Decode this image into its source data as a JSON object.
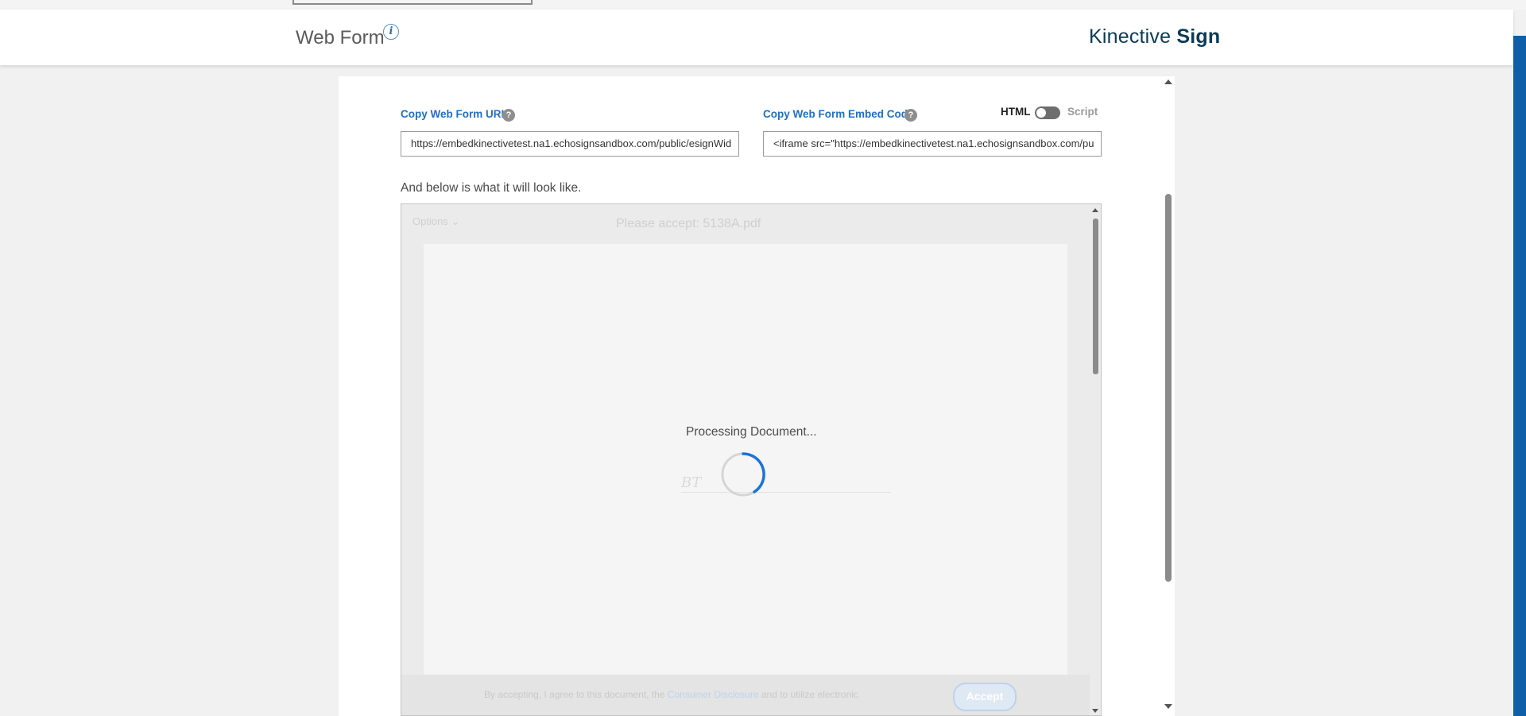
{
  "header": {
    "page_title": "Web Form",
    "info_icon": "i",
    "brand_light": "Kinective",
    "brand_bold": "Sign"
  },
  "form": {
    "url_label": "Copy Web Form URL",
    "url_value": "https://embedkinectivetest.na1.echosignsandbox.com/public/esignWid",
    "embed_label": "Copy Web Form Embed Code",
    "embed_value": "<iframe src=\"https://embedkinectivetest.na1.echosignsandbox.com/pu",
    "help_glyph": "?",
    "toggle_left": "HTML",
    "toggle_right": "Script",
    "toggle_state": "HTML"
  },
  "preview": {
    "caption": "And below is what it will look like.",
    "options_label": "Options ⌄",
    "doc_title": "Please accept: 5138A.pdf",
    "processing_text": "Processing Document...",
    "signature_mark": "BT",
    "footer_text_before": "By accepting, I agree to this document, the ",
    "footer_link": "Consumer Disclosure",
    "footer_text_after": " and to utilize electronic",
    "accept_label": "Accept"
  },
  "colors": {
    "accent": "#1f6fc5",
    "brand": "#0b3b55",
    "spinner": "#1a73d9",
    "right_edge": "#0f5fa8"
  }
}
